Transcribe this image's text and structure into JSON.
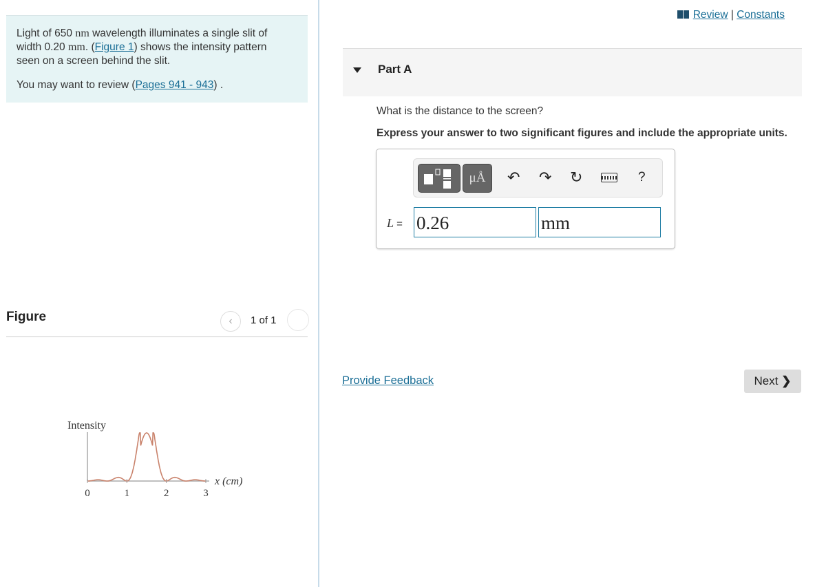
{
  "intro": {
    "line1_pre": "Light of 650 ",
    "unit_nm": "nm",
    "line1_post": " wavelength illuminates a single slit of",
    "line2_pre": "width 0.20 ",
    "unit_mm": "mm",
    ". ": "",
    "line2_mid": ". (",
    "figure_link": "Figure 1",
    "line2_post": ") shows the intensity pattern",
    "line3": "seen on a screen behind the slit.",
    "review_pre": "You may want to review (",
    "pages_link": "Pages 941 - 943",
    "review_post": ") ."
  },
  "figure": {
    "label": "Figure",
    "pager_text": "1 of 1",
    "prev_icon": "chevron-left-icon",
    "next_icon": "chevron-right-icon"
  },
  "chart_data": {
    "type": "line",
    "ylabel": "Intensity",
    "xlabel": "x (cm)",
    "xticks": [
      "0",
      "1",
      "2",
      "3"
    ],
    "xlim": [
      0,
      3
    ],
    "description_of_curve": "single-slit pattern: central max at x=1.5, minima at 0.5, 1, 2, 2.5",
    "color": "#c9826b"
  },
  "header": {
    "review": "Review",
    "sep": "|",
    "constants": "Constants"
  },
  "part": {
    "title": "Part A"
  },
  "question": "What is the distance to the screen?",
  "instructions": "Express your answer to two significant figures and include the appropriate units.",
  "answer": {
    "var": "L",
    "eq": " =",
    "value": "0.26",
    "unit": "mm"
  },
  "toolbar": {
    "units_label": "μÅ",
    "help": "?"
  },
  "footer": {
    "feedback": "Provide Feedback",
    "next": "Next"
  }
}
